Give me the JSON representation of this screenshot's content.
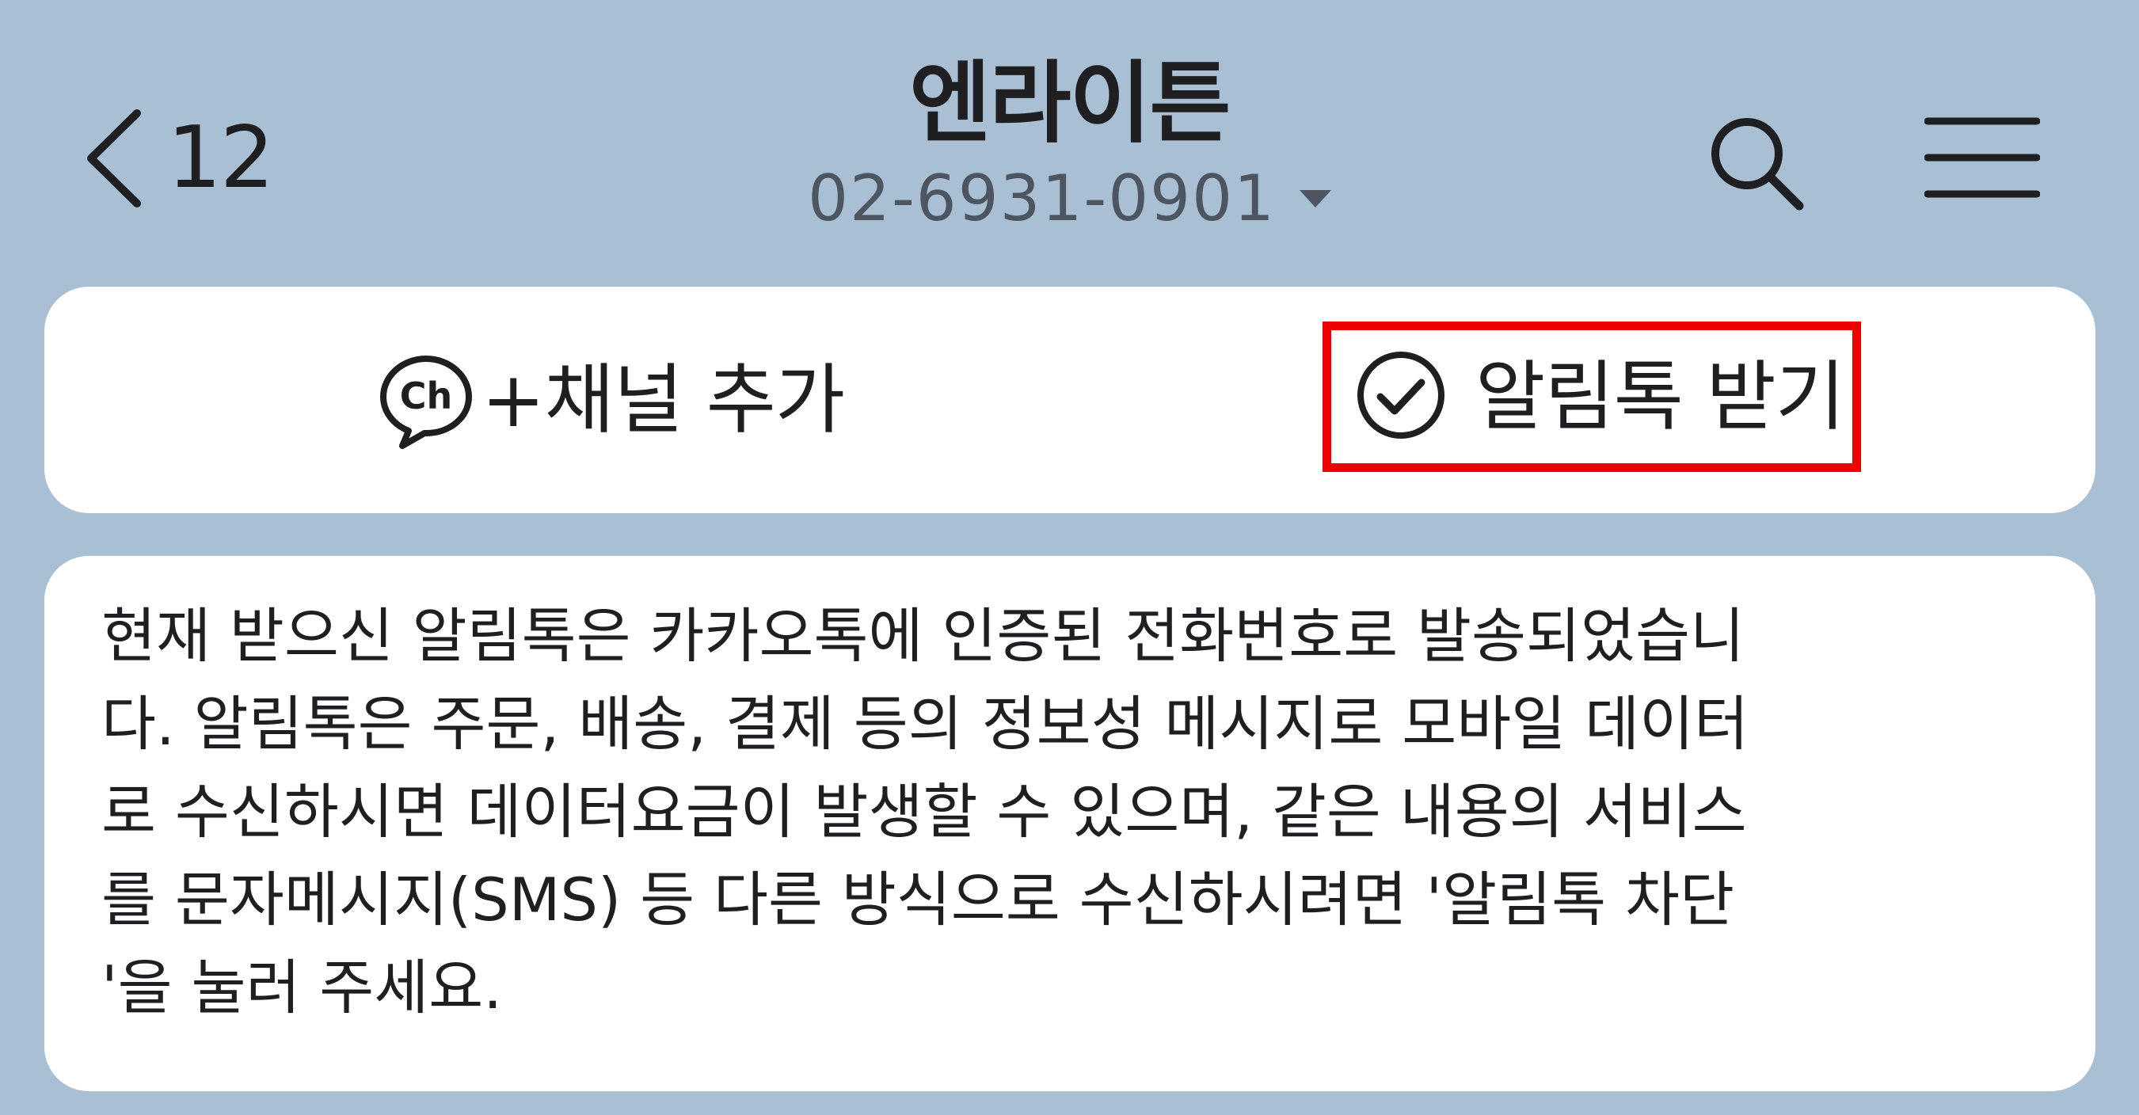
{
  "header": {
    "back_count": "12",
    "title": "엔라이튼",
    "subtitle": "02-6931-0901",
    "icons": {
      "back": "chevron-left-icon",
      "search": "search-icon",
      "menu": "hamburger-menu-icon",
      "dropdown": "caret-down-icon"
    }
  },
  "channel_card": {
    "add_channel_label": "+채널 추가",
    "alimtalk_label": "알림톡 받기",
    "highlight_color": "#ee0000"
  },
  "notice": {
    "lines": [
      "현재 받으신 알림톡은 카카오톡에 인증된 전화번호로 발송되었습니",
      "다. 알림톡은 주문, 배송, 결제 등의 정보성 메시지로 모바일 데이터",
      "로 수신하시면 데이터요금이 발생할 수 있으며, 같은 내용의 서비스",
      "를 문자메시지(SMS) 등 다른 방식으로 수신하시려면 '알림톡 차단",
      "'을 눌러 주세요."
    ]
  },
  "colors": {
    "background": "#a9bfd3",
    "card": "#ffffff",
    "text": "#1f1f21",
    "subtitle": "#4d5560"
  }
}
